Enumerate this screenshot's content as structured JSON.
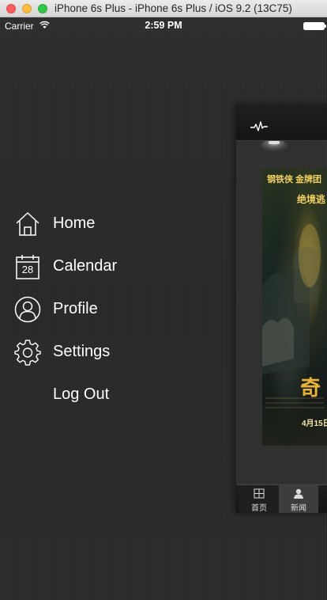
{
  "window": {
    "title": "iPhone 6s Plus - iPhone 6s Plus / iOS 9.2 (13C75)"
  },
  "status_bar": {
    "carrier": "Carrier",
    "time": "2:59 PM",
    "wifi_icon": "wifi-icon",
    "battery_icon": "battery-icon"
  },
  "menu": {
    "items": [
      {
        "label": "Home",
        "icon": "home-icon"
      },
      {
        "label": "Calendar",
        "icon": "calendar-icon",
        "icon_text": "28"
      },
      {
        "label": "Profile",
        "icon": "profile-icon"
      },
      {
        "label": "Settings",
        "icon": "gear-icon"
      },
      {
        "label": "Log Out",
        "icon": ""
      }
    ]
  },
  "main_panel": {
    "nav_icon": "pulse-icon",
    "poster": {
      "top_text": "钢铁侠 金牌团",
      "sub_text": "绝境逃",
      "title_text": "奇",
      "date_text": "4月15日"
    },
    "tabs": [
      {
        "label": "首页",
        "icon": "grid-icon",
        "selected": false
      },
      {
        "label": "新闻",
        "icon": "person-icon",
        "selected": true
      }
    ]
  },
  "colors": {
    "background": "#2b2b2b",
    "menu_text": "#ffffff",
    "poster_gold": "#f2d061"
  }
}
